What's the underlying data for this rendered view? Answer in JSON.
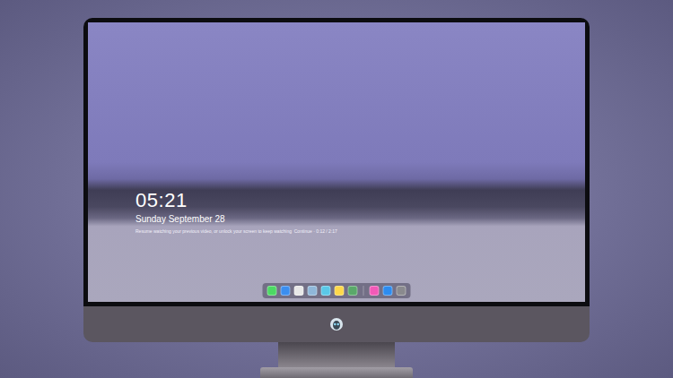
{
  "lock_screen": {
    "time": "05:21",
    "date": "Sunday September 28",
    "notice": "Resume watching your previous video, or unlock your screen to keep watching  Continue · 0:12 / 2:17"
  },
  "dock": {
    "groups": [
      {
        "apps": [
          {
            "color": "#4cd964"
          },
          {
            "color": "#3b8ef0"
          },
          {
            "color": "#e8e8e8"
          },
          {
            "color": "#8fb7d9"
          },
          {
            "color": "#5ac8e8"
          },
          {
            "color": "#ffd84a"
          },
          {
            "color": "#5aa86a"
          }
        ]
      },
      {
        "apps": [
          {
            "color": "#f25ab8"
          },
          {
            "color": "#2d8cf0"
          },
          {
            "color": "#8a8a8e"
          }
        ]
      }
    ]
  }
}
